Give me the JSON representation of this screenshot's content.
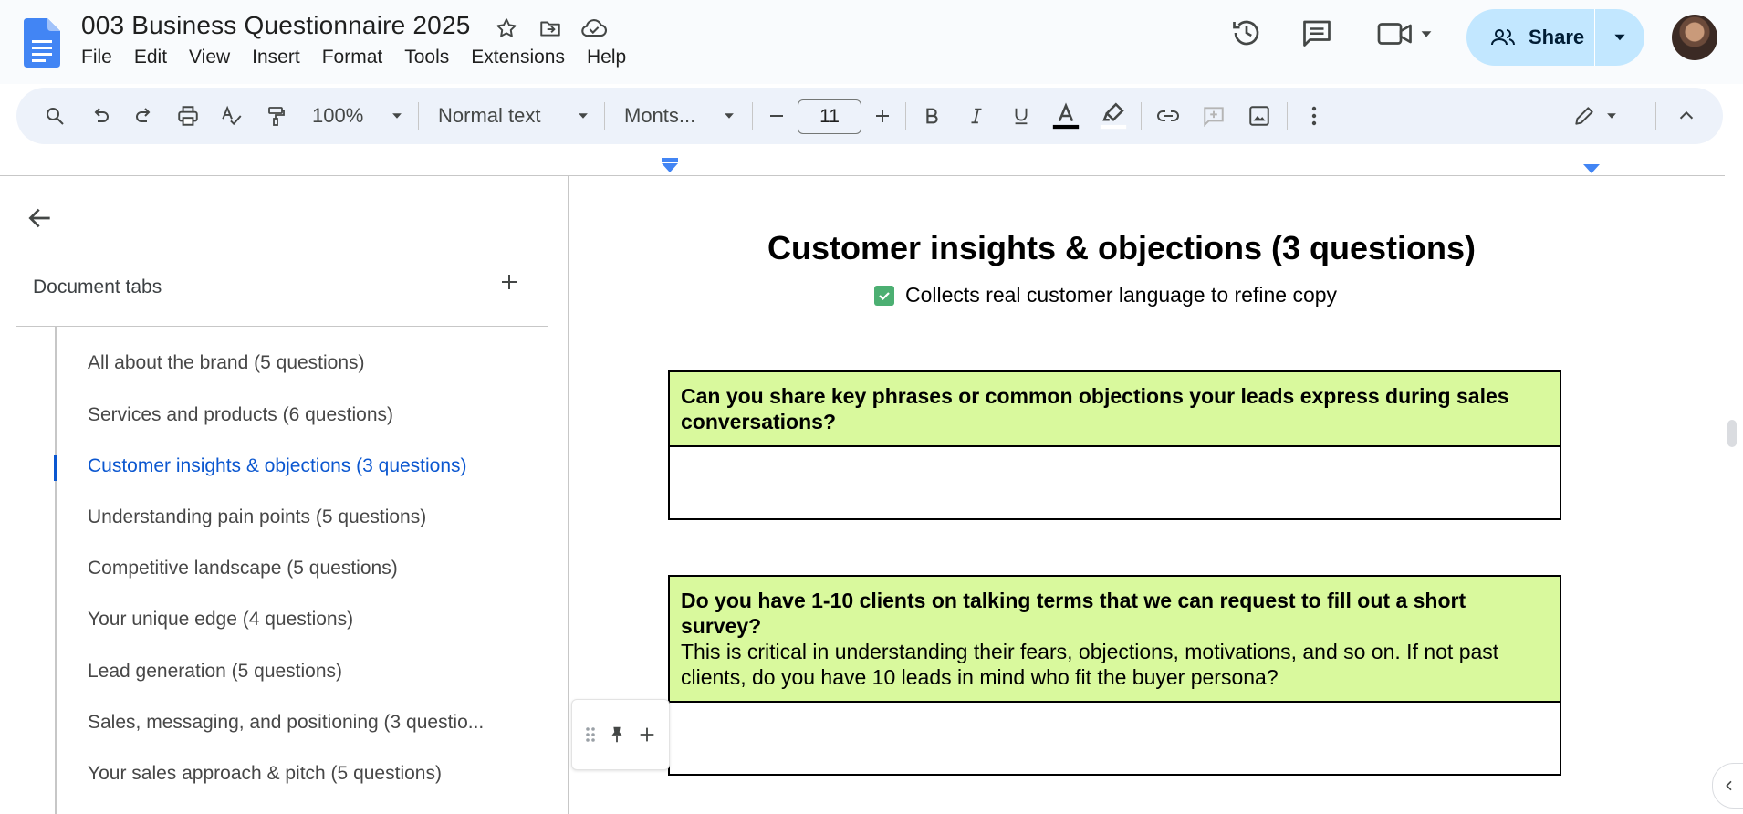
{
  "header": {
    "title": "003 Business Questionnaire 2025",
    "menu": [
      "File",
      "Edit",
      "View",
      "Insert",
      "Format",
      "Tools",
      "Extensions",
      "Help"
    ],
    "share_label": "Share"
  },
  "toolbar": {
    "zoom": "100%",
    "style": "Normal text",
    "font": "Monts...",
    "font_size": "11"
  },
  "sidebar": {
    "header": "Document tabs",
    "tabs": [
      {
        "label": "All about the brand (5 questions)"
      },
      {
        "label": "Services and products (6 questions)"
      },
      {
        "label": "Customer insights & objections (3 questions)",
        "active": true
      },
      {
        "label": "Understanding pain points (5 questions)"
      },
      {
        "label": "Competitive landscape (5 questions)"
      },
      {
        "label": "Your unique edge (4 questions)"
      },
      {
        "label": "Lead generation (5 questions)"
      },
      {
        "label": "Sales, messaging, and positioning (3 questio..."
      },
      {
        "label": "Your sales approach & pitch (5 questions)"
      }
    ]
  },
  "document": {
    "heading": "Customer insights & objections (3 questions)",
    "subline": "Collects real customer language to refine copy",
    "questions": [
      {
        "question": "Can you share key phrases or common objections your leads express during sales conversations?",
        "note": ""
      },
      {
        "question": "Do you have 1-10 clients on talking terms that we can request to fill out a short survey?",
        "note": "This is critical in understanding their fears, objections, motivations, and so on. If not past clients, do you have 10 leads in mind who fit the buyer persona?"
      }
    ]
  },
  "colors": {
    "accent": "#0b57d0",
    "share_bg": "#c2e7ff",
    "question_bg": "#d9f99d",
    "toolbar_bg": "#edf2fa",
    "check_green": "#4caf72"
  },
  "icons": {
    "doc": "google-docs-icon",
    "star": "star-icon",
    "move": "move-to-folder-icon",
    "cloud": "cloud-saved-icon",
    "history": "version-history-icon",
    "comments": "comments-icon",
    "meet": "meet-icon"
  }
}
